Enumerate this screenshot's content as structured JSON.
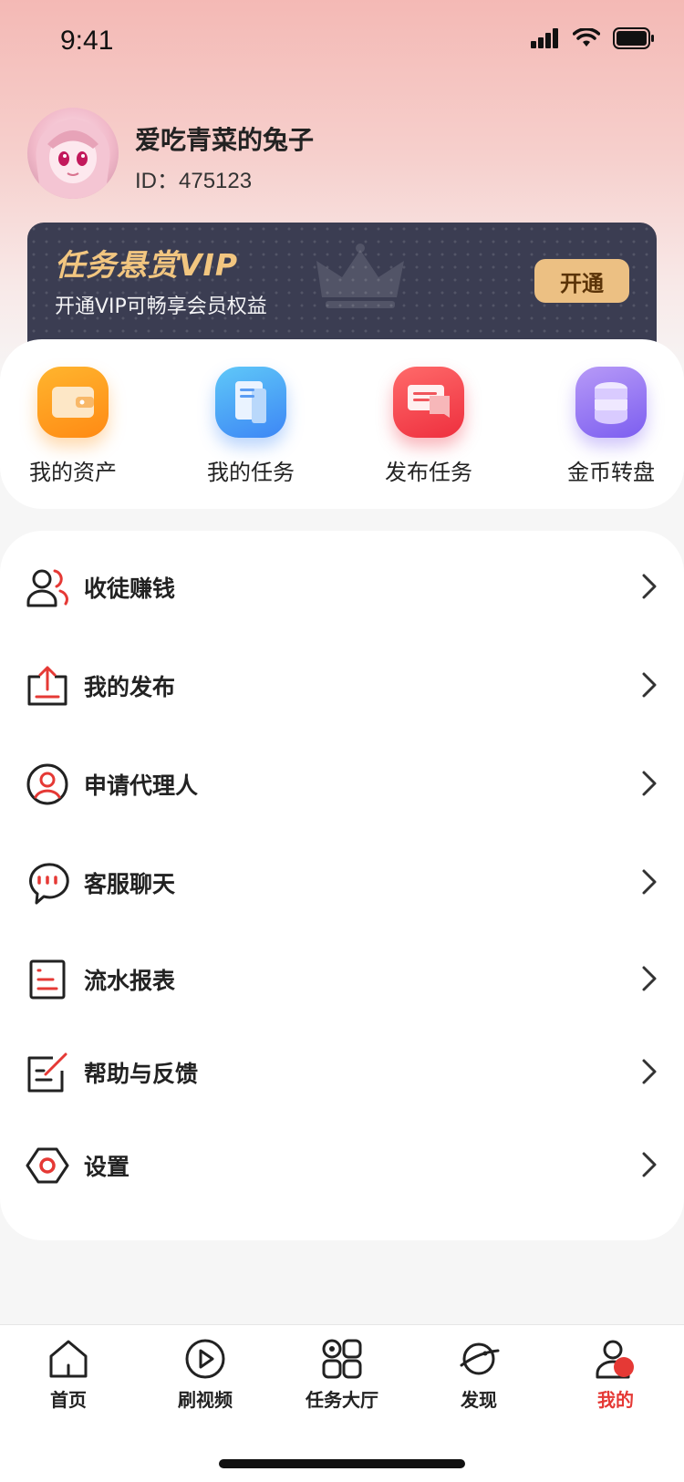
{
  "status_bar": {
    "time": "9:41",
    "signal_icon": "signal-bars-icon",
    "wifi_icon": "wifi-icon",
    "battery_icon": "battery-icon"
  },
  "profile": {
    "avatar_icon": "avatar-anime-girl",
    "username": "爱吃青菜的兔子",
    "id_text": "ID：475123"
  },
  "vip": {
    "title": "任务悬赏VIP",
    "subtitle": "开通VIP可畅享会员权益",
    "button_label": "开通",
    "crown_icon": "crown-icon"
  },
  "quick_actions": [
    {
      "label": "我的资产",
      "icon": "wallet-icon",
      "color": "#ff9a1f"
    },
    {
      "label": "我的任务",
      "icon": "document-icon",
      "color": "#3d9bf5"
    },
    {
      "label": "发布任务",
      "icon": "chat-icon",
      "color": "#f4474a"
    },
    {
      "label": "金币转盘",
      "icon": "coins-icon",
      "color": "#9b7cf2"
    }
  ],
  "menu": [
    {
      "label": "收徒赚钱",
      "icon": "recruit-users-icon"
    },
    {
      "label": "我的发布",
      "icon": "upload-icon"
    },
    {
      "label": "申请代理人",
      "icon": "user-circle-icon"
    },
    {
      "label": "客服聊天",
      "icon": "chat-bubble-icon"
    },
    {
      "label": "流水报表",
      "icon": "report-icon"
    },
    {
      "label": "帮助与反馈",
      "icon": "feedback-edit-icon"
    },
    {
      "label": "设置",
      "icon": "settings-icon"
    }
  ],
  "tab_bar": [
    {
      "label": "首页",
      "icon": "home-icon",
      "active": false
    },
    {
      "label": "刷视频",
      "icon": "play-icon",
      "active": false
    },
    {
      "label": "任务大厅",
      "icon": "grid-icon",
      "active": false
    },
    {
      "label": "发现",
      "icon": "planet-icon",
      "active": false
    },
    {
      "label": "我的",
      "icon": "profile-icon",
      "active": true
    }
  ],
  "colors": {
    "accent_red": "#e53935",
    "vip_gold": "#ecc083",
    "vip_dark": "#3b3d52"
  }
}
